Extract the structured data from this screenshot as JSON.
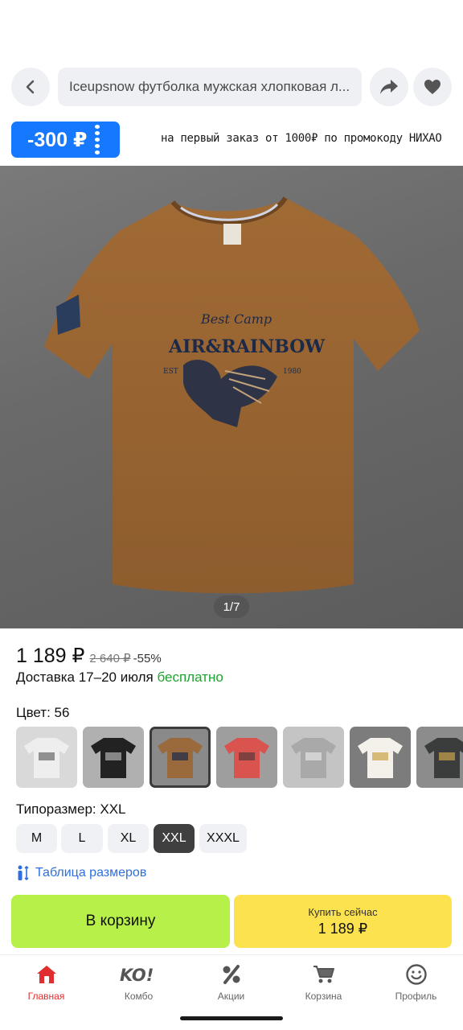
{
  "header": {
    "search_text": "Iceupsnow футболка мужская хлопковая л...",
    "back_icon": "chevron-left-icon",
    "share_icon": "share-arrow-icon",
    "favorite_icon": "heart-icon"
  },
  "promo": {
    "coupon_amount": "-300 ₽",
    "text": "на первый заказ от 1000₽ по промокоду НИХАО"
  },
  "product": {
    "image_counter": "1/7",
    "print_line1": "Best Camp",
    "print_line2": "AIR&RAINBOW",
    "print_left": "EST",
    "print_right": "1980",
    "price": "1 189 ₽",
    "old_price": "2 640 ₽",
    "discount": "-55%",
    "delivery_prefix": "Доставка 17–20 июля",
    "delivery_free": "бесплатно"
  },
  "color": {
    "label": "Цвет: 56",
    "swatches": [
      {
        "color": "#eeeeee",
        "selected": false
      },
      {
        "color": "#222222",
        "selected": false
      },
      {
        "color": "#9a6a3c",
        "selected": true
      },
      {
        "color": "#d9534f",
        "selected": false
      },
      {
        "color": "#a9a9a9",
        "selected": false
      },
      {
        "color": "#f4f1ea",
        "selected": false
      },
      {
        "color": "#3a3d3c",
        "selected": false
      }
    ]
  },
  "size": {
    "label": "Типоразмер: XXL",
    "options": [
      "M",
      "L",
      "XL",
      "XXL",
      "XXXL"
    ],
    "selected": "XXL",
    "table_link": "Таблица размеров"
  },
  "actions": {
    "cart_label": "В корзину",
    "buy_now_label": "Купить сейчас",
    "buy_now_price": "1 189 ₽"
  },
  "nav": {
    "items": [
      {
        "label": "Главная",
        "icon": "home-icon",
        "active": true
      },
      {
        "label": "Комбо",
        "icon": "ko-logo-icon",
        "active": false
      },
      {
        "label": "Акции",
        "icon": "percent-icon",
        "active": false
      },
      {
        "label": "Корзина",
        "icon": "cart-icon",
        "active": false
      },
      {
        "label": "Профиль",
        "icon": "profile-icon",
        "active": false
      }
    ]
  },
  "colors": {
    "accent_blue": "#1677ff",
    "cart_green": "#b8f04a",
    "buy_yellow": "#fde24f",
    "free_green": "#1fa32f",
    "nav_active_red": "#e02d2d"
  }
}
